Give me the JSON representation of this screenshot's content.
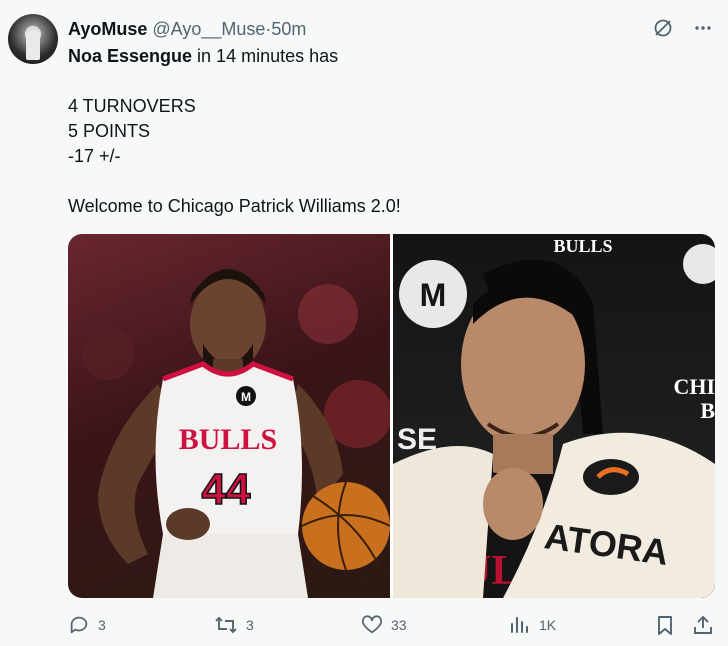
{
  "post": {
    "display_name": "AyoMuse",
    "handle": "@Ayo__Muse",
    "separator": "·",
    "time": "50m",
    "text_bold": "Noa Essengue",
    "text_rest": " in 14 minutes has\n\n4 TURNOVERS\n5 POINTS\n-17 +/-\n\nWelcome to Chicago Patrick Williams 2.0!",
    "images": [
      {
        "jersey_text": "BULLS",
        "number": "44",
        "logo": "M"
      },
      {
        "banner_text": "BULLS",
        "side_text_1": "CHI",
        "side_text_2": "B",
        "sign_text": "SE",
        "towel_text": "ATORA",
        "shirt_text": "BUL",
        "logo": "M"
      }
    ]
  },
  "actions": {
    "replies": "3",
    "reposts": "3",
    "likes": "33",
    "views": "1K"
  },
  "icons": [
    "grok-icon",
    "more-icon",
    "reply-icon",
    "repost-icon",
    "like-icon",
    "views-icon",
    "bookmark-icon",
    "share-icon"
  ],
  "colors": {
    "accent": "#1d9bf0",
    "muted": "#536471",
    "text": "#0f1419",
    "bulls_red": "#ce1141"
  }
}
